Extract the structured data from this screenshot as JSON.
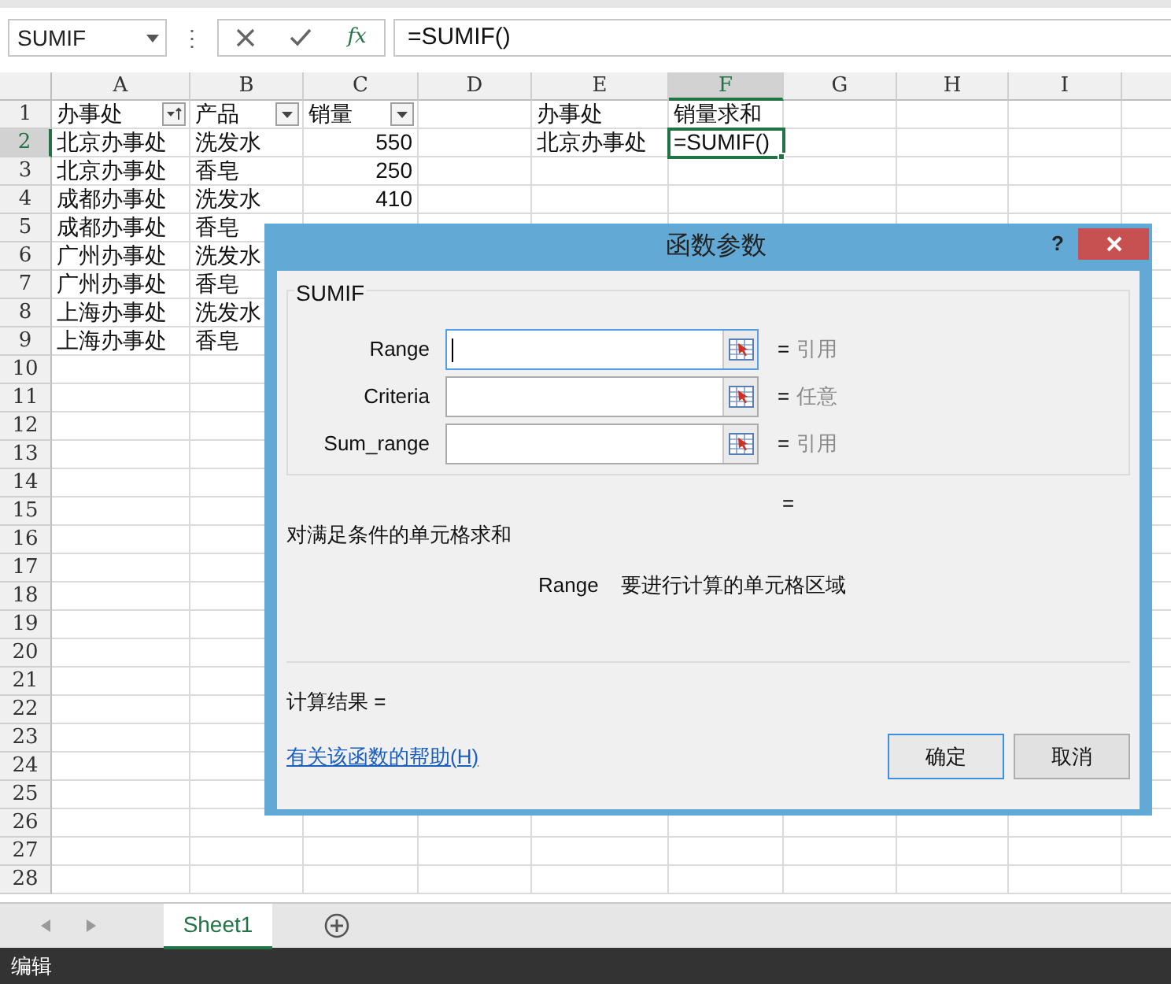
{
  "name_box": "SUMIF",
  "menu_glyph": "⋮",
  "function_button": "fx",
  "formula": "=SUMIF()",
  "columns": [
    {
      "label": "A",
      "selected": false
    },
    {
      "label": "B",
      "selected": false
    },
    {
      "label": "C",
      "selected": false
    },
    {
      "label": "D",
      "selected": false
    },
    {
      "label": "E",
      "selected": false
    },
    {
      "label": "F",
      "selected": true
    },
    {
      "label": "G",
      "selected": false
    },
    {
      "label": "H",
      "selected": false
    },
    {
      "label": "I",
      "selected": false
    }
  ],
  "rows": [
    {
      "label": "1",
      "selected": false,
      "cells": {
        "A": {
          "text": "办事处",
          "kind": "text",
          "filter_button": true,
          "sorted": true
        },
        "B": {
          "text": "产品",
          "kind": "text",
          "filter_button": true,
          "sorted": false
        },
        "C": {
          "text": "销量",
          "kind": "text",
          "filter_button": true,
          "sorted": false
        },
        "E": {
          "text": "办事处",
          "kind": "text"
        },
        "F": {
          "text": "销量求和",
          "kind": "text"
        }
      }
    },
    {
      "label": "2",
      "selected": true,
      "cells": {
        "A": {
          "text": "北京办事处",
          "kind": "text"
        },
        "B": {
          "text": "洗发水",
          "kind": "text"
        },
        "C": {
          "text": "550",
          "kind": "number"
        },
        "E": {
          "text": "北京办事处",
          "kind": "text"
        },
        "F": {
          "text": "=SUMIF()",
          "kind": "text"
        }
      }
    },
    {
      "label": "3",
      "selected": false,
      "cells": {
        "A": {
          "text": "北京办事处",
          "kind": "text"
        },
        "B": {
          "text": "香皂",
          "kind": "text"
        },
        "C": {
          "text": "250",
          "kind": "number"
        }
      }
    },
    {
      "label": "4",
      "selected": false,
      "cells": {
        "A": {
          "text": "成都办事处",
          "kind": "text"
        },
        "B": {
          "text": "洗发水",
          "kind": "text"
        },
        "C": {
          "text": "410",
          "kind": "number"
        }
      }
    },
    {
      "label": "5",
      "selected": false,
      "cells": {
        "A": {
          "text": "成都办事处",
          "kind": "text"
        },
        "B": {
          "text": "香皂",
          "kind": "text"
        }
      }
    },
    {
      "label": "6",
      "selected": false,
      "cells": {
        "A": {
          "text": "广州办事处",
          "kind": "text"
        },
        "B": {
          "text": "洗发水",
          "kind": "text"
        }
      }
    },
    {
      "label": "7",
      "selected": false,
      "cells": {
        "A": {
          "text": "广州办事处",
          "kind": "text"
        },
        "B": {
          "text": "香皂",
          "kind": "text"
        }
      }
    },
    {
      "label": "8",
      "selected": false,
      "cells": {
        "A": {
          "text": "上海办事处",
          "kind": "text"
        },
        "B": {
          "text": "洗发水",
          "kind": "text"
        }
      }
    },
    {
      "label": "9",
      "selected": false,
      "cells": {
        "A": {
          "text": "上海办事处",
          "kind": "text"
        },
        "B": {
          "text": "香皂",
          "kind": "text"
        }
      }
    },
    {
      "label": "10",
      "selected": false
    },
    {
      "label": "11",
      "selected": false
    },
    {
      "label": "12",
      "selected": false
    },
    {
      "label": "13",
      "selected": false
    },
    {
      "label": "14",
      "selected": false
    },
    {
      "label": "15",
      "selected": false
    },
    {
      "label": "16",
      "selected": false
    },
    {
      "label": "17",
      "selected": false
    },
    {
      "label": "18",
      "selected": false
    },
    {
      "label": "19",
      "selected": false
    },
    {
      "label": "20",
      "selected": false
    },
    {
      "label": "21",
      "selected": false
    },
    {
      "label": "22",
      "selected": false
    },
    {
      "label": "23",
      "selected": false
    },
    {
      "label": "24",
      "selected": false
    },
    {
      "label": "25",
      "selected": false
    },
    {
      "label": "26",
      "selected": false
    },
    {
      "label": "27",
      "selected": false
    },
    {
      "label": "28",
      "selected": false
    }
  ],
  "dialog": {
    "title": "函数参数",
    "help_button": "?",
    "function_name": "SUMIF",
    "arguments": [
      {
        "label": "Range",
        "equals": "=",
        "hint": "引用",
        "focused": true
      },
      {
        "label": "Criteria",
        "equals": "=",
        "hint": "任意",
        "focused": false
      },
      {
        "label": "Sum_range",
        "equals": "=",
        "hint": "引用",
        "focused": false
      }
    ],
    "result_equals": "=",
    "description": "对满足条件的单元格求和",
    "argument_help": {
      "name": "Range",
      "text": "要进行计算的单元格区域"
    },
    "result_label": "计算结果 =",
    "help_link": "有关该函数的帮助(H)",
    "buttons": [
      {
        "label": "确定",
        "default": true
      },
      {
        "label": "取消",
        "default": false
      }
    ]
  },
  "sheet_tabs": [
    {
      "label": "Sheet1",
      "selected": true
    }
  ],
  "status": "编辑"
}
